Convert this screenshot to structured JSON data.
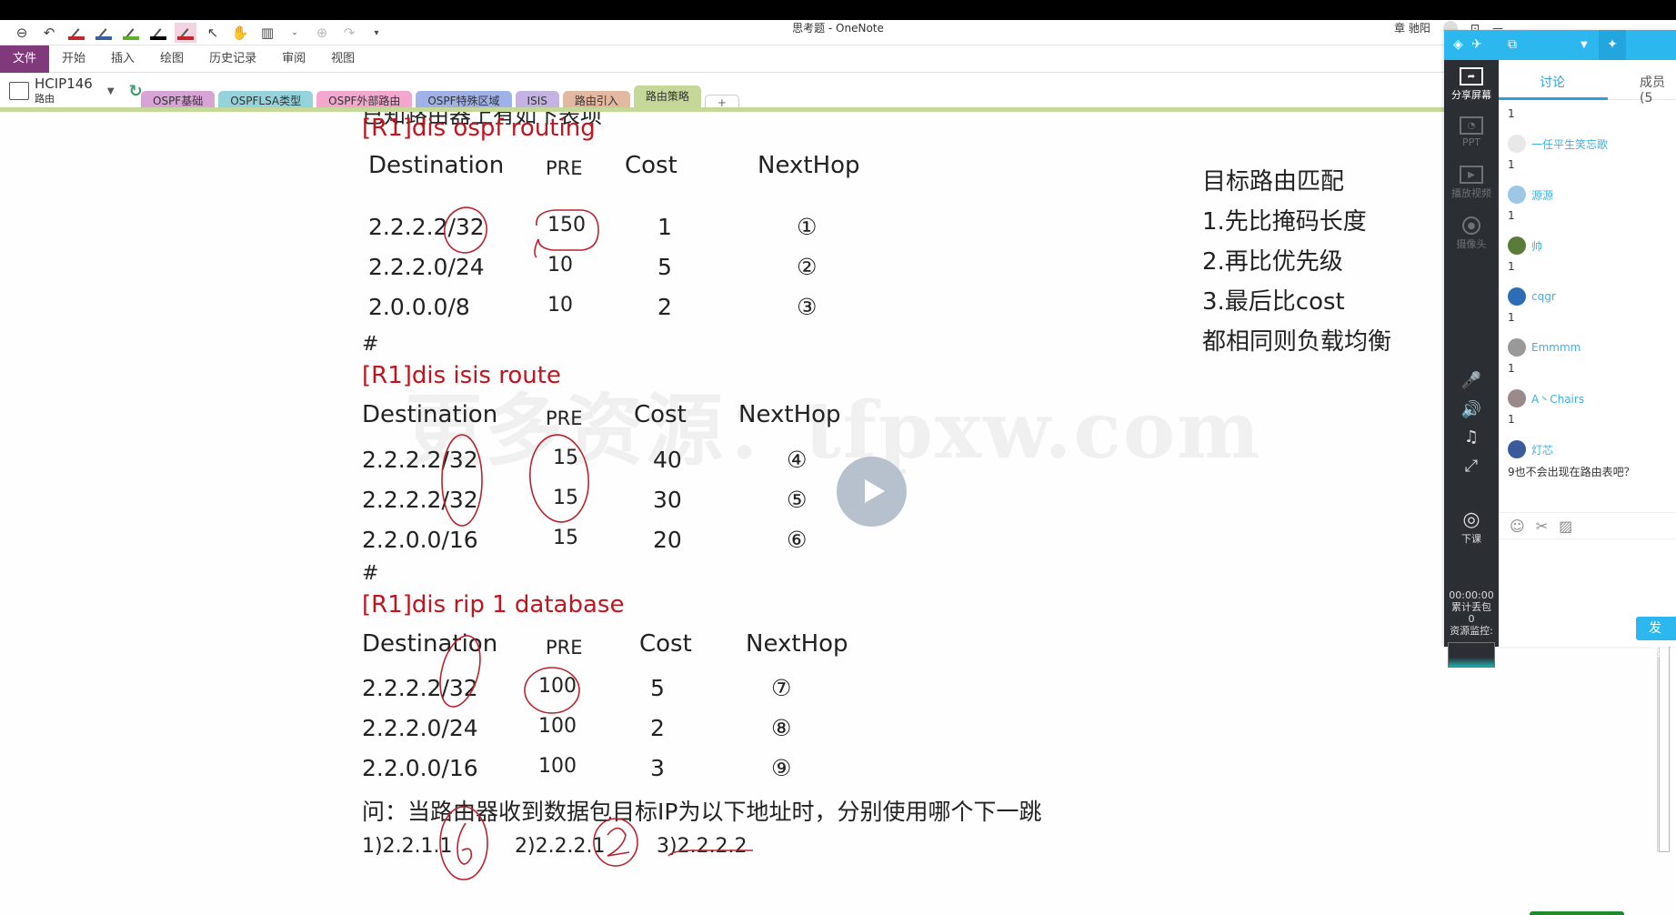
{
  "window": {
    "title": "思考题 - OneNote",
    "user_name": "章 驰阳"
  },
  "quick_access": {
    "pen_colors": [
      "#c0262d",
      "#3a5f9c",
      "#5fae2e",
      "#000000",
      "#c0262d"
    ]
  },
  "ribbon": {
    "tabs": [
      "文件",
      "开始",
      "插入",
      "绘图",
      "历史记录",
      "审阅",
      "视图"
    ]
  },
  "notebook": {
    "name": "HCIP146",
    "section_group": "路由"
  },
  "sections": [
    {
      "label": "OSPF基础",
      "color": "#d8a3d6"
    },
    {
      "label": "OSPFLSA类型",
      "color": "#95d3dc"
    },
    {
      "label": "OSPF外部路由",
      "color": "#f3a7cf"
    },
    {
      "label": "OSPF特殊区域",
      "color": "#9fb1e6"
    },
    {
      "label": "ISIS",
      "color": "#c4b2e3"
    },
    {
      "label": "路由引入",
      "color": "#e3b8a0"
    },
    {
      "label": "路由策略",
      "color": "#c5d89a",
      "active": true
    },
    {
      "label": "+",
      "add": true
    }
  ],
  "page": {
    "clipped_heading": "已知路由器上有如下表项",
    "ospf": {
      "command": "[R1]dis ospf routing",
      "headers": [
        "Destination",
        "PRE",
        "Cost",
        "NextHop"
      ],
      "rows": [
        [
          "2.2.2.2/32",
          "150",
          "1",
          "①"
        ],
        [
          "2.2.2.0/24",
          "10",
          "5",
          "②"
        ],
        [
          "2.0.0.0/8",
          "10",
          "2",
          "③"
        ]
      ]
    },
    "hash": "#",
    "isis": {
      "command": "[R1]dis isis route",
      "headers": [
        "Destination",
        "PRE",
        "Cost",
        "NextHop"
      ],
      "rows": [
        [
          "2.2.2.2/32",
          "15",
          "40",
          "④"
        ],
        [
          "2.2.2.2/32",
          "15",
          "30",
          "⑤"
        ],
        [
          "2.2.0.0/16",
          "15",
          "20",
          "⑥"
        ]
      ]
    },
    "rip": {
      "command": "[R1]dis rip 1 database",
      "headers": [
        "Destination",
        "PRE",
        "Cost",
        "NextHop"
      ],
      "rows": [
        [
          "2.2.2.2/32",
          "100",
          "5",
          "⑦"
        ],
        [
          "2.2.2.0/24",
          "100",
          "2",
          "⑧"
        ],
        [
          "2.2.0.0/16",
          "100",
          "3",
          "⑨"
        ]
      ]
    },
    "question": "问：当路由器收到数据包目标IP为以下地址时，分别使用哪个下一跳",
    "answers": [
      "1)2.2.1.1",
      "2)2.2.2.1",
      "3)2.2.2.2"
    ],
    "handwritten_answers": [
      "6",
      "2"
    ],
    "rules": [
      "目标路由匹配",
      "1.先比掩码长度",
      "2.再比优先级",
      "3.最后比cost",
      "都相同则负载均衡"
    ],
    "watermark": "更多资源：tfpxw.com"
  },
  "class_panel": {
    "side_items": [
      "分享屏幕",
      "PPT",
      "播放视频",
      "摄像头"
    ],
    "end_class": "下课",
    "timer": "00:00:00",
    "packet_loss_label": "累计丢包",
    "packet_loss_value": "0",
    "resource_monitor": "资源监控:",
    "tabs": [
      "讨论",
      "成员(5"
    ],
    "messages": [
      {
        "text": "1"
      },
      {
        "user": "一任平生笑忘歌",
        "avatar": "#e8e8e8"
      },
      {
        "text": "1"
      },
      {
        "user": "源源",
        "avatar": "#9cc8e6"
      },
      {
        "text": "1"
      },
      {
        "user": "帅",
        "avatar": "#5b7b3a"
      },
      {
        "text": "1"
      },
      {
        "user": "cqgr",
        "avatar": "#2d6db5"
      },
      {
        "text": "1"
      },
      {
        "user": "Emmmm",
        "avatar": "#999"
      },
      {
        "text": "1"
      },
      {
        "user": "A丶Chairs",
        "avatar": "#9a8a8c"
      },
      {
        "text": "1"
      },
      {
        "user": "灯芯",
        "avatar": "#3a5a9a"
      },
      {
        "text": "9也不会出现在路由表吧？"
      }
    ],
    "send_label": "发 送"
  }
}
